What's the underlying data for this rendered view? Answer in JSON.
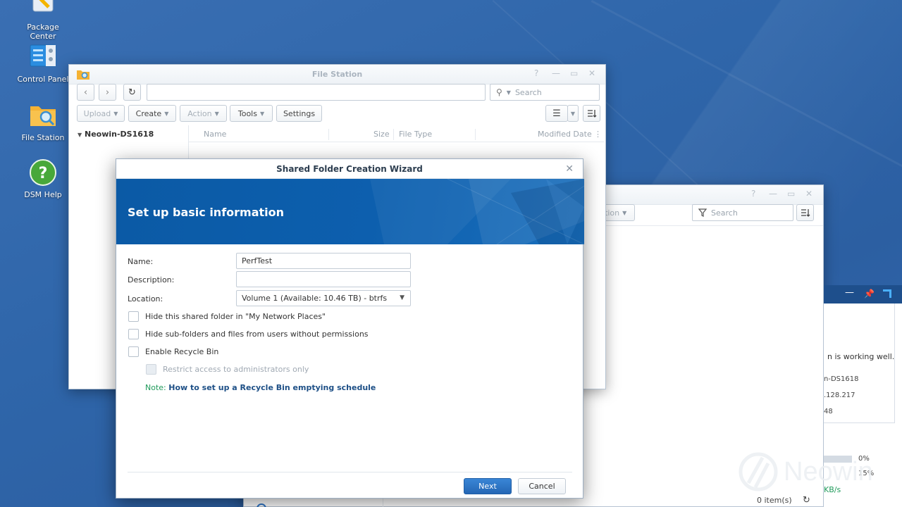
{
  "desktop": {
    "icons": [
      {
        "label": "Package\nCenter",
        "name": "package-center"
      },
      {
        "label": "Control Panel",
        "name": "control-panel"
      },
      {
        "label": "File Station",
        "name": "file-station"
      },
      {
        "label": "DSM Help",
        "name": "dsm-help"
      }
    ]
  },
  "file_station": {
    "title": "File Station",
    "search_placeholder": "Search",
    "toolbar": {
      "upload": "Upload",
      "create": "Create",
      "action": "Action",
      "tools": "Tools",
      "settings": "Settings"
    },
    "tree_root": "Neowin-DS1618",
    "columns": [
      "Name",
      "Size",
      "File Type",
      "Modified Date"
    ]
  },
  "back_window": {
    "action": "Action",
    "search_placeholder": "Search",
    "status_count": "0 item(s)"
  },
  "widget": {
    "status_text": "n is working well.",
    "lines": [
      "n-DS1618",
      ".128.217",
      "48"
    ],
    "percent1": "0%",
    "percent2": "15%",
    "speed": "KB/s"
  },
  "wizard": {
    "title": "Shared Folder Creation Wizard",
    "banner_title": "Set up basic information",
    "name_label": "Name:",
    "name_value": "PerfTest",
    "description_label": "Description:",
    "description_value": "",
    "location_label": "Location:",
    "location_value": "Volume 1 (Available: 10.46 TB) - btrfs",
    "options": {
      "hide_network_places": "Hide this shared folder in \"My Network Places\"",
      "hide_subfolders": "Hide sub-folders and files from users without permissions",
      "recycle_bin": "Enable Recycle Bin",
      "restrict_admin": "Restrict access to administrators only"
    },
    "note_label": "Note:",
    "note_link": "How to set up a Recycle Bin emptying schedule",
    "next": "Next",
    "cancel": "Cancel"
  },
  "watermark": "Neowin",
  "colors": {
    "desktop": "#2e64a7",
    "banner": "#0d5fae",
    "primary_button": "#2f76c6",
    "link": "#1d4f86",
    "note": "#1f9a5a"
  }
}
